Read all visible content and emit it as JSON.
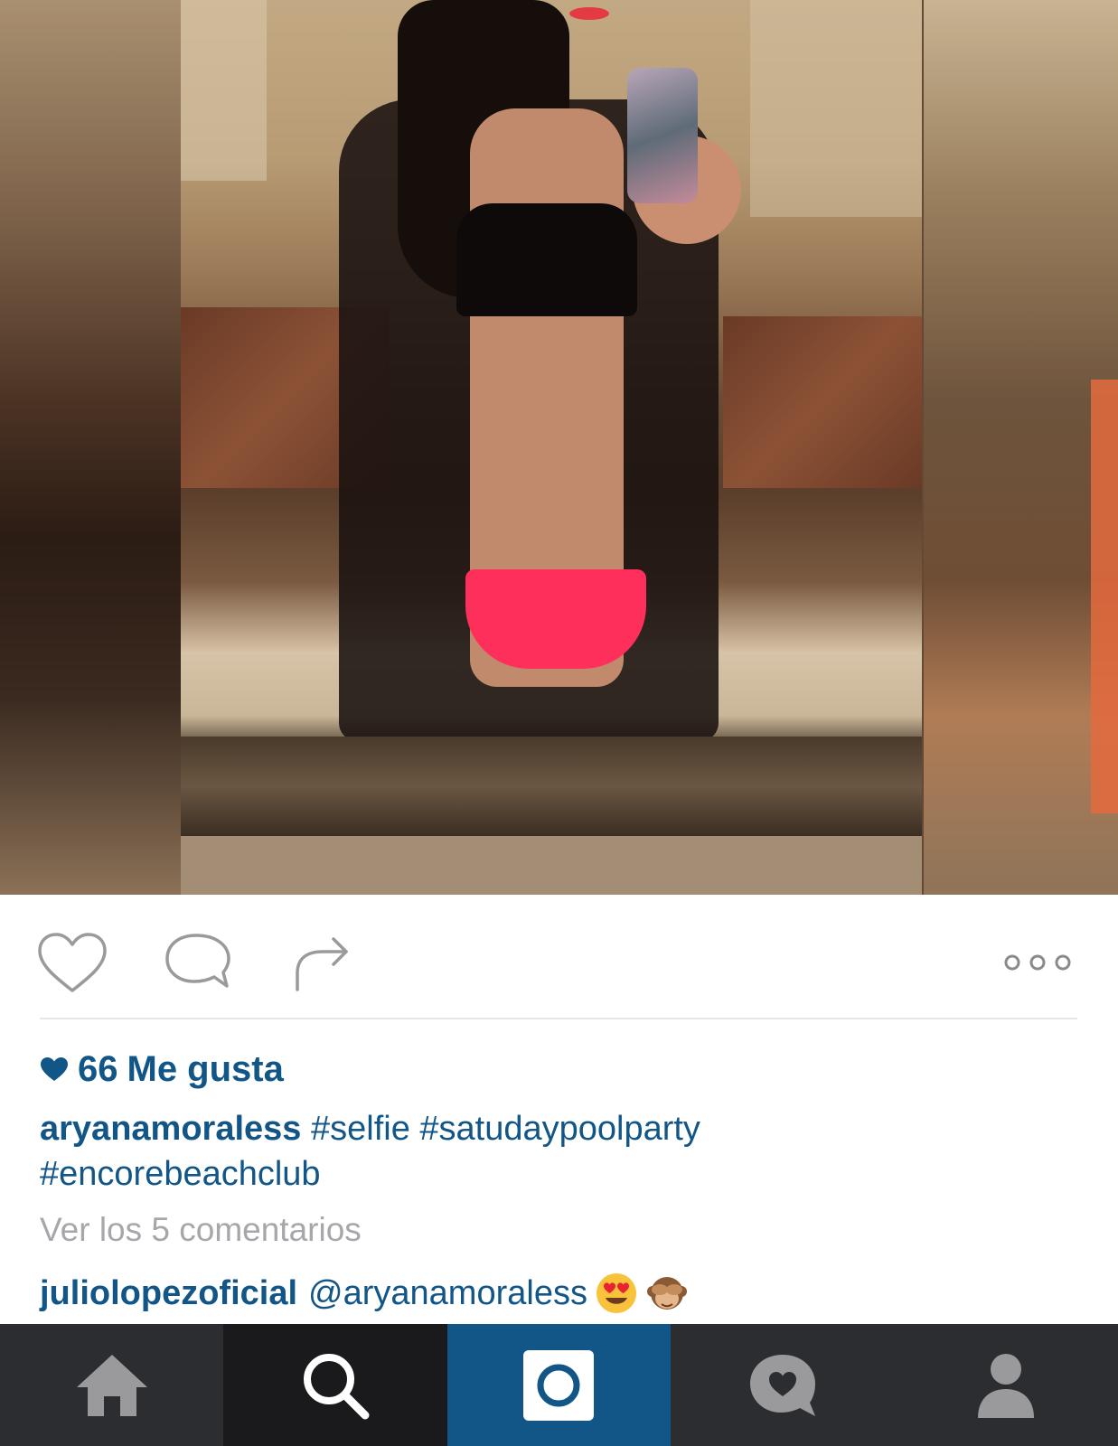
{
  "post": {
    "likes_count": "66",
    "likes_label": "Me gusta",
    "author": "aryanamoraless",
    "caption_tags_line1": "#selfie #satudaypoolparty",
    "caption_tags_line2": "#encorebeachclub",
    "view_comments": "Ver los 5 comentarios",
    "comment_author": "juliolopezoficial",
    "comment_text": "@aryanamoraless",
    "comment_emojis": [
      "heart-eyes-emoji",
      "see-no-evil-monkey-emoji"
    ]
  },
  "actions": [
    "heart-icon",
    "comment-icon",
    "share-icon",
    "more-options-icon"
  ],
  "tabbar": {
    "tabs": [
      "home-icon",
      "search-icon",
      "camera-icon",
      "activity-icon",
      "profile-icon"
    ],
    "active": "search"
  },
  "colors": {
    "link_blue": "#125688",
    "muted_gray": "#a5a7aa",
    "tabbar_bg": "#2b2d31",
    "tab_active_bg": "#1a1a1c",
    "camera_tab_bg": "#125688"
  }
}
